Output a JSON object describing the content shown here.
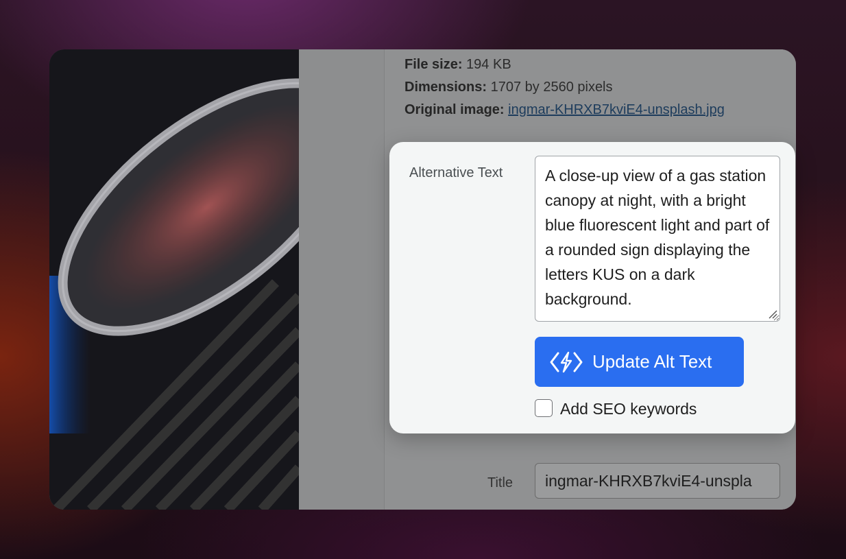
{
  "attachment": {
    "file_size_label": "File size:",
    "file_size_value": "194 KB",
    "dimensions_label": "Dimensions:",
    "dimensions_value": "1707 by 2560 pixels",
    "original_label": "Original image:",
    "original_link": "ingmar-KHRXB7kviE4-unsplash.jpg"
  },
  "alt_text": {
    "label": "Alternative Text",
    "value": "A close-up view of a gas station canopy at night, with a bright blue fluorescent light and part of a rounded sign displaying the letters KUS on a dark background.",
    "update_button": "Update Alt Text",
    "seo_checkbox_label": "Add SEO keywords",
    "seo_checked": false,
    "update_icon": "sparkle-code-icon",
    "accent_color": "#2a6ef0"
  },
  "title_field": {
    "label": "Title",
    "value": "ingmar-KHRXB7kviE4-unspla"
  }
}
